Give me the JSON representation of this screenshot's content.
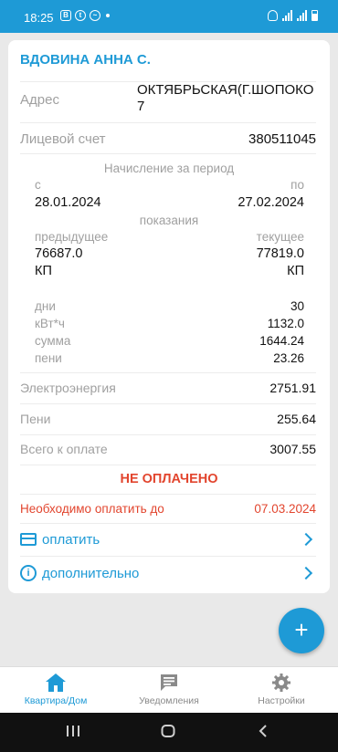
{
  "status_bar": {
    "time": "18:25",
    "left_icons": [
      "b-badge-icon",
      "tb-icon",
      "messenger-icon"
    ],
    "right_icons": [
      "alarm-icon",
      "signal-icon",
      "4g-signal-icon",
      "battery-icon"
    ]
  },
  "account": {
    "name": "ВДОВИНА АННА С.",
    "address_label": "Адрес",
    "address_value": "ОКТЯБРЬСКАЯ(Г.ШОПОКО 7",
    "account_label": "Лицевой счет",
    "account_value": "380511045"
  },
  "period": {
    "title": "Начисление за период",
    "from_label": "с",
    "to_label": "по",
    "from_date": "28.01.2024",
    "to_date": "27.02.2024"
  },
  "readings": {
    "title": "показания",
    "prev_label": "предыдущее",
    "curr_label": "текущее",
    "prev_value": "76687.0",
    "curr_value": "77819.0",
    "prev_unit": "КП",
    "curr_unit": "КП"
  },
  "stats": [
    {
      "label": "дни",
      "value": "30"
    },
    {
      "label": "кВт*ч",
      "value": "1132.0"
    },
    {
      "label": "сумма",
      "value": "1644.24"
    },
    {
      "label": "пени",
      "value": "23.26"
    }
  ],
  "totals": {
    "electricity_label": "Электроэнергия",
    "electricity_value": "2751.91",
    "penalty_label": "Пени",
    "penalty_value": "255.64",
    "total_label": "Всего к оплате",
    "total_value": "3007.55"
  },
  "payment_status": "НЕ ОПЛАЧЕНО",
  "due": {
    "label": "Необходимо оплатить до",
    "date": "07.03.2024"
  },
  "actions": {
    "pay_label": "оплатить",
    "more_label": "дополнительно"
  },
  "fab_symbol": "+",
  "bottom_nav": [
    {
      "label": "Квартира/Дом",
      "icon": "home-icon",
      "active": true
    },
    {
      "label": "Уведомления",
      "icon": "chat-icon",
      "active": false
    },
    {
      "label": "Настройки",
      "icon": "gear-icon",
      "active": false
    }
  ],
  "colors": {
    "accent": "#1e9ad6",
    "alert": "#e2452e",
    "background": "#e9e9e9"
  }
}
